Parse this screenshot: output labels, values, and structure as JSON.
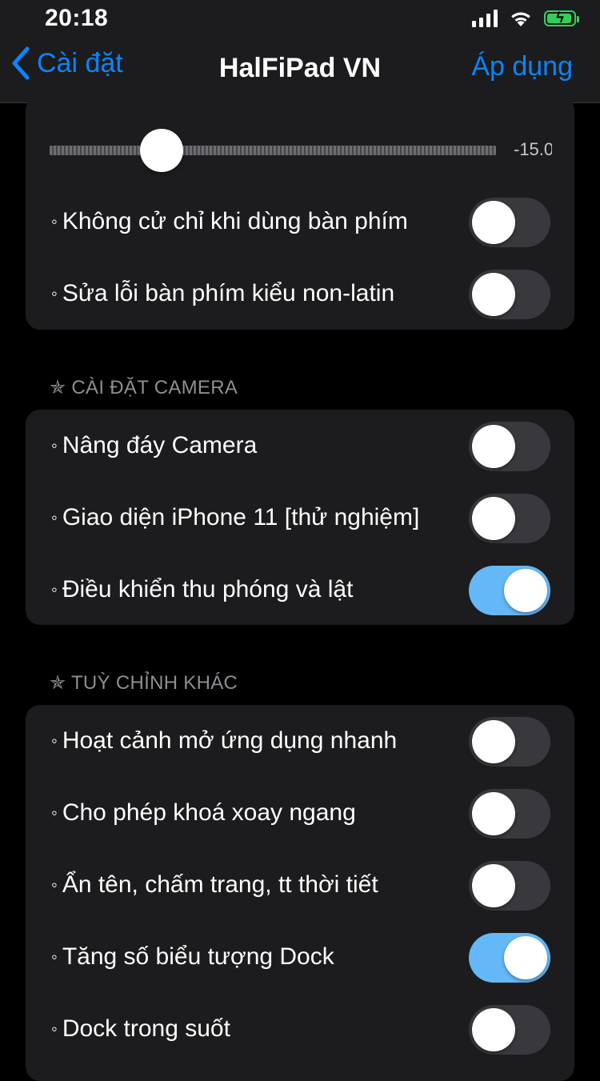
{
  "status_bar": {
    "time": "20:18",
    "icons": [
      "signal-icon",
      "wifi-icon",
      "battery-charging-icon"
    ]
  },
  "nav": {
    "back_label": "Cài đặt",
    "title": "HalFiPad VN",
    "action_label": "Áp dụng"
  },
  "colors": {
    "accent": "#0a84ff",
    "toggle_on": "#64b8f7",
    "toggle_off": "#39393d",
    "group_bg": "#1c1c1e",
    "battery": "#30d158"
  },
  "group1": {
    "slider": {
      "value_text": "-15.0",
      "fraction": 0.25
    },
    "rows": [
      {
        "label": "Không cử chỉ khi dùng bàn phím",
        "on": false
      },
      {
        "label": "Sửa lỗi bàn phím kiểu non-latin",
        "on": false
      }
    ]
  },
  "camera_section": {
    "header": "CÀI ĐẶT CAMERA",
    "rows": [
      {
        "label": "Nâng đáy Camera",
        "on": false
      },
      {
        "label": "Giao diện iPhone 11 [thử nghiệm]",
        "on": false
      },
      {
        "label": "Điều khiển thu phóng và lật",
        "on": true
      }
    ]
  },
  "other_section": {
    "header": "TUỲ CHỈNH KHÁC",
    "rows": [
      {
        "label": "Hoạt cảnh mở ứng dụng nhanh",
        "on": false
      },
      {
        "label": "Cho phép khoá xoay ngang",
        "on": false
      },
      {
        "label": "Ẩn tên, chấm trang, tt thời tiết",
        "on": false
      },
      {
        "label": "Tăng số biểu tượng Dock",
        "on": true
      },
      {
        "label": "Dock trong suốt",
        "on": false
      }
    ]
  }
}
